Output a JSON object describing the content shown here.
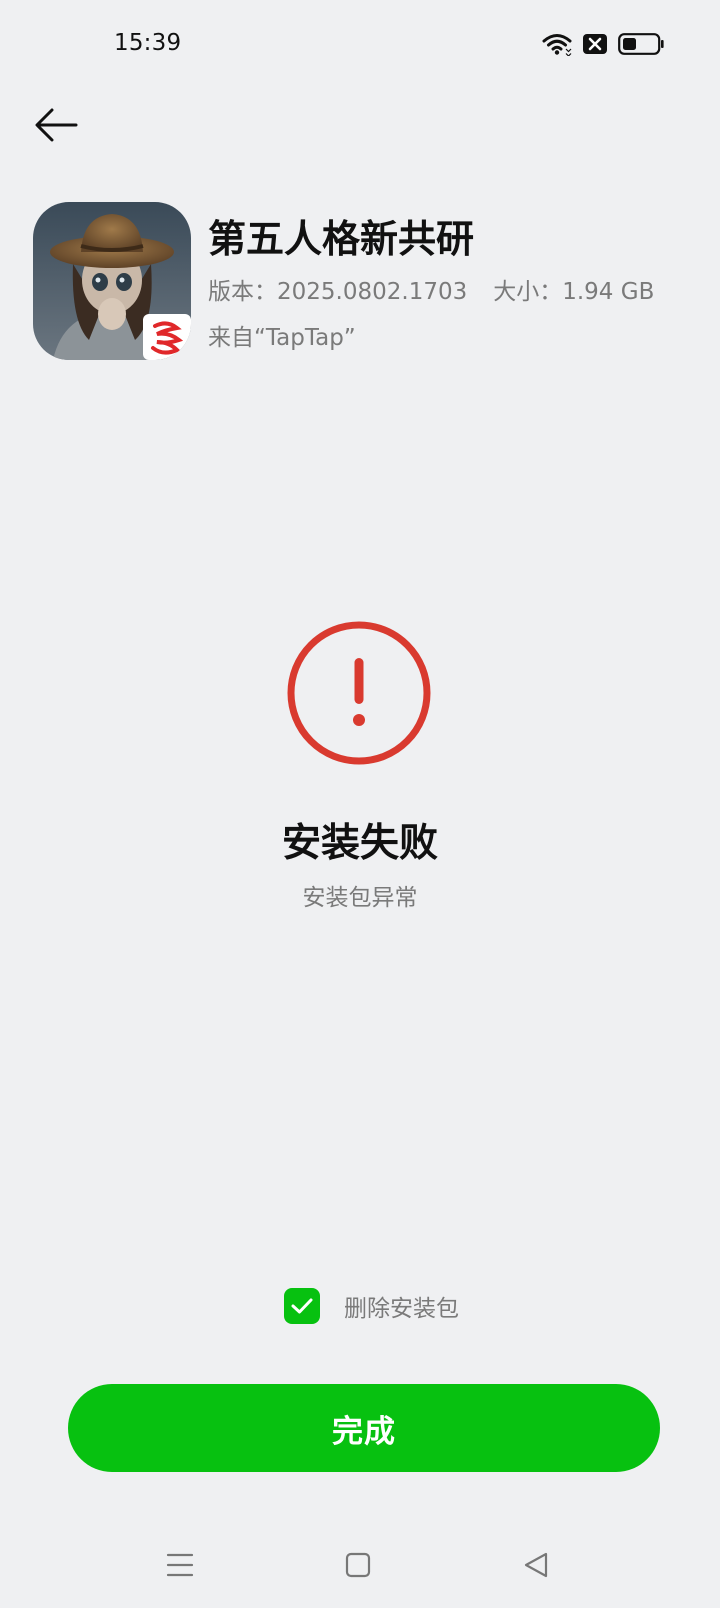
{
  "status_bar": {
    "time": "15:39",
    "icons": [
      "wifi-icon",
      "no-sim-icon",
      "battery-icon"
    ]
  },
  "header": {
    "back_icon": "arrow-left-icon"
  },
  "app": {
    "name": "第五人格新共研",
    "version_label": "版本：2025.0802.1703",
    "size_label": "大小：1.94 GB",
    "source_label": "来自“TapTap”"
  },
  "result": {
    "icon": "error-exclamation-icon",
    "title": "安装失败",
    "subtitle": "安装包异常",
    "accent_color": "#d93a2f"
  },
  "options": {
    "delete_package_label": "删除安装包",
    "delete_package_checked": true
  },
  "actions": {
    "done_label": "完成",
    "accent_color": "#07c110"
  },
  "navigation_bar": {
    "items": [
      "menu-icon",
      "home-icon",
      "back-triangle-icon"
    ]
  }
}
